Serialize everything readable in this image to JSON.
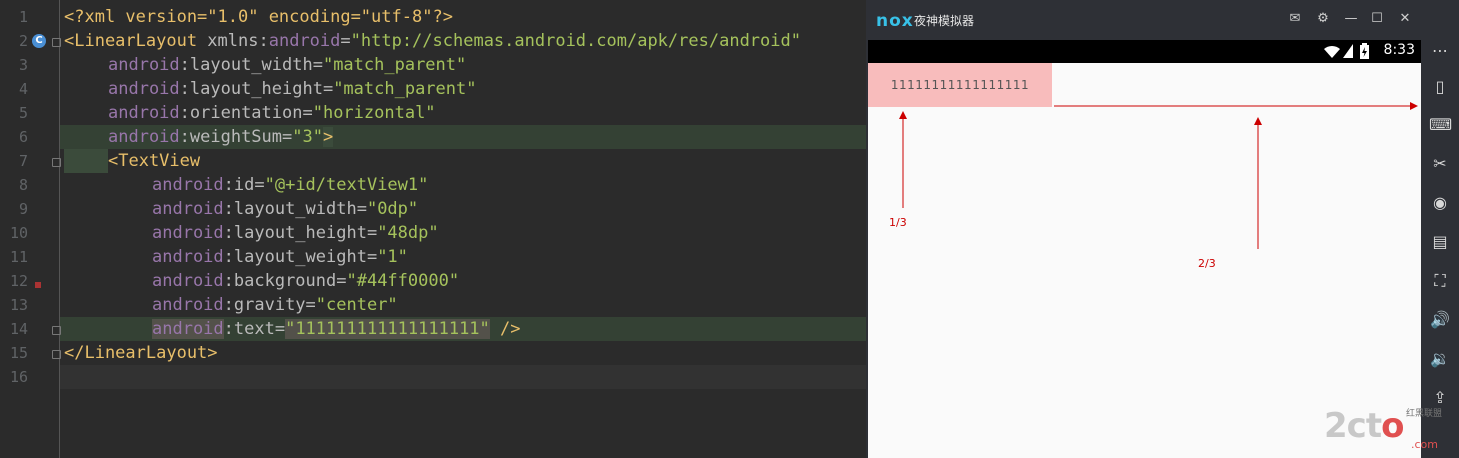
{
  "editor": {
    "line_numbers": [
      "1",
      "2",
      "3",
      "4",
      "5",
      "6",
      "7",
      "8",
      "9",
      "10",
      "11",
      "12",
      "13",
      "14",
      "15",
      "16"
    ],
    "gutter_badge": "C",
    "lines": {
      "l1": {
        "pi_open": "<?xml version=\"1.0\" encoding=\"utf-8\"?>"
      },
      "l2": {
        "tag": "<LinearLayout ",
        "ns": "xmlns",
        "colon": ":",
        "attr": "android",
        "eq": "=",
        "val": "\"http://schemas.android.com/apk/res/android\""
      },
      "l3": {
        "ns": "android",
        "attr": ":layout_width=",
        "val": "\"match_parent\""
      },
      "l4": {
        "ns": "android",
        "attr": ":layout_height=",
        "val": "\"match_parent\""
      },
      "l5": {
        "ns": "android",
        "attr": ":orientation=",
        "val": "\"horizontal\""
      },
      "l6": {
        "ns": "android",
        "attr": ":weightSum=",
        "val": "\"3\"",
        "close": ">"
      },
      "l7": {
        "tag": "<TextView"
      },
      "l8": {
        "ns": "android",
        "attr": ":id=",
        "val": "\"@+id/textView1\""
      },
      "l9": {
        "ns": "android",
        "attr": ":layout_width=",
        "val": "\"0dp\""
      },
      "l10": {
        "ns": "android",
        "attr": ":layout_height=",
        "val": "\"48dp\""
      },
      "l11": {
        "ns": "android",
        "attr": ":layout_weight=",
        "val": "\"1\""
      },
      "l12": {
        "ns": "android",
        "attr": ":background=",
        "val": "\"#44ff0000\""
      },
      "l13": {
        "ns": "android",
        "attr": ":gravity=",
        "val": "\"center\""
      },
      "l14": {
        "ns": "android",
        "attr": ":text=",
        "val": "\"111111111111111111\"",
        "close": " />"
      },
      "l15": {
        "tag": "</LinearLayout>"
      }
    }
  },
  "emulator": {
    "logo": "nox",
    "title": "夜神模拟器",
    "clock": "8:33",
    "textview_text": "11111111111111111",
    "label_one_third": "1/3",
    "label_two_thirds": "2/3",
    "watermark": {
      "main_a": "2c",
      "main_o": "t",
      "main_b": "o",
      "small": "红黑联盟",
      "url": ".com"
    }
  },
  "icons": {
    "title_bar": [
      "mail-icon",
      "settings-icon",
      "minimize-icon",
      "maximize-icon",
      "close-icon"
    ],
    "sidebar": [
      "more-icon",
      "rotate-icon",
      "keyboard-icon",
      "scissors-icon",
      "location-icon",
      "multi-window-icon",
      "fullscreen-icon",
      "volume-up-icon",
      "volume-down-icon",
      "apk-install-icon"
    ]
  },
  "colors": {
    "editor_bg": "#2b2b2b",
    "textview_bg": "#f8bcbc",
    "annotation_red": "#cc0000",
    "nox_accent": "#38c1e8"
  }
}
